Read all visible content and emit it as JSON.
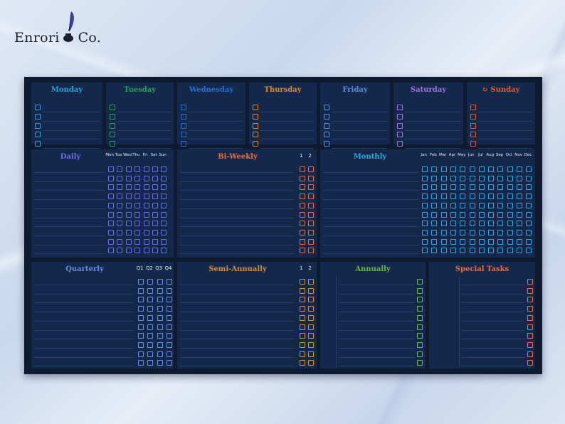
{
  "brand": {
    "name": "Enrori",
    "suffix": "Co."
  },
  "colors": {
    "monday": "#2fa2d6",
    "tuesday": "#25a35a",
    "wednesday": "#2b6fd9",
    "thursday": "#e08a2a",
    "friday": "#5a8fe0",
    "saturday": "#a571e0",
    "sunday": "#ec5a2c",
    "daily": "#6f6ee6",
    "biweekly": "#ef6a3c",
    "monthly": "#38a7e0",
    "quarterly": "#6a8fe0",
    "semiannual": "#e08a2a",
    "annually": "#6aba3c",
    "special": "#ef6a3c"
  },
  "days": [
    {
      "label": "Monday",
      "color_key": "monday"
    },
    {
      "label": "Tuesday",
      "color_key": "tuesday"
    },
    {
      "label": "Wednesday",
      "color_key": "wednesday"
    },
    {
      "label": "Thursday",
      "color_key": "thursday"
    },
    {
      "label": "Friday",
      "color_key": "friday"
    },
    {
      "label": "Saturday",
      "color_key": "saturday"
    },
    {
      "label": "Sunday",
      "color_key": "sunday",
      "icon": "rotate-icon"
    }
  ],
  "daily": {
    "title": "Daily",
    "columns": [
      "Mon",
      "Tue",
      "Wed",
      "Thu",
      "Fri",
      "Sat",
      "Sun"
    ]
  },
  "biweekly": {
    "title": "Bi-Weekly",
    "columns": [
      "1",
      "2"
    ]
  },
  "monthly": {
    "title": "Monthly",
    "columns": [
      "Jan",
      "Feb",
      "Mar",
      "Apr",
      "May",
      "Jun",
      "Jul",
      "Aug",
      "Sep",
      "Oct",
      "Nov",
      "Dec"
    ]
  },
  "quarterly": {
    "title": "Quarterly",
    "columns": [
      "Q1",
      "Q2",
      "Q3",
      "Q4"
    ]
  },
  "semiannual": {
    "title": "Semi-Annually",
    "columns": [
      "1",
      "2"
    ]
  },
  "annually": {
    "title": "Annually"
  },
  "special": {
    "title": "Special Tasks"
  }
}
